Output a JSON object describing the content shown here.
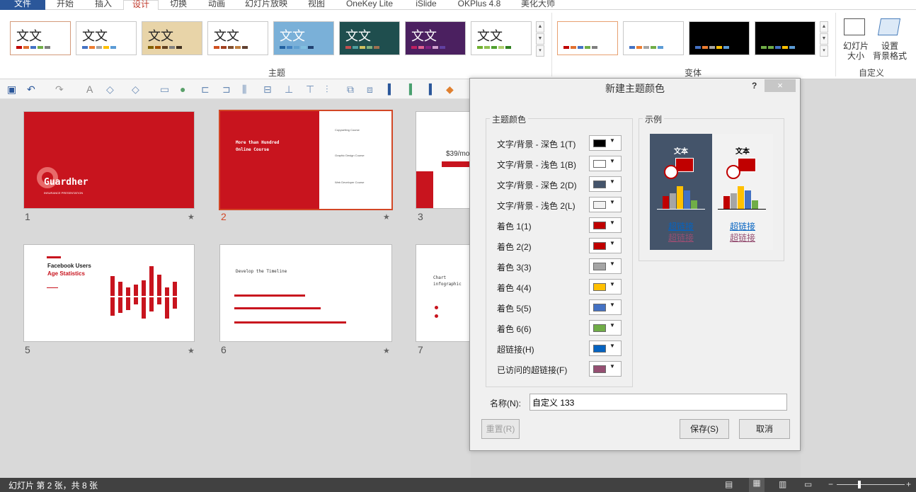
{
  "tabs": [
    "文件",
    "开始",
    "插入",
    "设计",
    "切换",
    "动画",
    "幻灯片放映",
    "视图",
    "OneKey Lite",
    "iSlide",
    "OKPlus 4.8",
    "美化大师"
  ],
  "ribbon": {
    "themes": [
      {
        "label": "文文",
        "bg": "#ffffff",
        "border": "#d39a7a",
        "colors": [
          "#c00000",
          "#e07030",
          "#4472c4",
          "#70ad47",
          "#7f7f7f"
        ]
      },
      {
        "label": "文文",
        "bg": "#ffffff",
        "border": "#c8c8c8",
        "colors": [
          "#4472c4",
          "#ed7d31",
          "#a5a5a5",
          "#ffc000",
          "#5b9bd5"
        ]
      },
      {
        "label": "文文",
        "bg": "#e8d4a8",
        "border": "#c8c8c8",
        "colors": [
          "#7f6000",
          "#a05000",
          "#604020",
          "#808080",
          "#403020"
        ]
      },
      {
        "label": "文文",
        "bg": "#ffffff",
        "border": "#c8c8c8",
        "colors": [
          "#d05020",
          "#a04020",
          "#805030",
          "#c08040",
          "#604030"
        ]
      },
      {
        "label": "文文",
        "bg": "#7ab0d8",
        "border": "#c8c8c8",
        "colors": [
          "#2060a0",
          "#4080c0",
          "#60a0d0",
          "#80c0e0",
          "#204070"
        ]
      },
      {
        "label": "文文",
        "bg": "#1f4e4e",
        "border": "#c8c8c8",
        "colors": [
          "#c05050",
          "#50a0a0",
          "#d0c060",
          "#80b080",
          "#a07050"
        ]
      },
      {
        "label": "文文",
        "bg": "#4b2060",
        "border": "#c8c8c8",
        "colors": [
          "#c02060",
          "#e06090",
          "#802080",
          "#d0a0d0",
          "#6040a0"
        ]
      },
      {
        "label": "文文",
        "bg": "#ffffff",
        "border": "#c8c8c8",
        "colors": [
          "#70b030",
          "#90c050",
          "#50a030",
          "#b0d070",
          "#308020"
        ]
      }
    ],
    "variants": [
      {
        "bg": "#ffffff",
        "border": "#e8a070",
        "colors": [
          "#c00000",
          "#e07030",
          "#4472c4",
          "#70ad47",
          "#7f7f7f"
        ]
      },
      {
        "bg": "#ffffff",
        "border": "#c8c8c8",
        "colors": [
          "#4472c4",
          "#ed7d31",
          "#a5a5a5",
          "#70ad47",
          "#5b9bd5"
        ]
      },
      {
        "bg": "#000000",
        "border": "#c8c8c8",
        "colors": [
          "#4472c4",
          "#ed7d31",
          "#a5a5a5",
          "#ffc000",
          "#5b9bd5"
        ]
      },
      {
        "bg": "#000000",
        "border": "#c8c8c8",
        "colors": [
          "#70ad47",
          "#70ad47",
          "#4472c4",
          "#ffc000",
          "#5b9bd5"
        ]
      }
    ],
    "group_theme": "主题",
    "group_variant": "变体",
    "group_custom": "自定义",
    "slide_size": "幻灯片\n大小",
    "format_bg": "设置\n背景格式"
  },
  "slides": [
    {
      "num": "1",
      "title": "Guardher",
      "sub": "INSURANCE PRESENTATION"
    },
    {
      "num": "2",
      "title": "More than Hundred Online Course",
      "items": [
        "Copywriting Course",
        "Graphic Design Course",
        "Web Developer Course"
      ]
    },
    {
      "num": "3",
      "title": "$39/mo"
    },
    {
      "num": "5",
      "title": "Facebook Users",
      "title2": "Age Statistics"
    },
    {
      "num": "6",
      "title": "Develop the Timeline"
    },
    {
      "num": "7",
      "title": "Chart infographic"
    }
  ],
  "dialog": {
    "title": "新建主题颜色",
    "help": "?",
    "close": "×",
    "theme_colors_label": "主题颜色",
    "sample_label": "示例",
    "rows": [
      {
        "label": "文字/背景 - 深色 1(T)",
        "color": "#000000"
      },
      {
        "label": "文字/背景 - 浅色 1(B)",
        "color": "#ffffff"
      },
      {
        "label": "文字/背景 - 深色 2(D)",
        "color": "#44546a"
      },
      {
        "label": "文字/背景 - 浅色 2(L)",
        "color": "#f2f2f2"
      },
      {
        "label": "着色 1(1)",
        "color": "#c00000"
      },
      {
        "label": "着色 2(2)",
        "color": "#c00000"
      },
      {
        "label": "着色 3(3)",
        "color": "#a5a5a5"
      },
      {
        "label": "着色 4(4)",
        "color": "#ffc000"
      },
      {
        "label": "着色 5(5)",
        "color": "#4472c4"
      },
      {
        "label": "着色 6(6)",
        "color": "#70ad47"
      },
      {
        "label": "超链接(H)",
        "color": "#0563c1"
      },
      {
        "label": "已访问的超链接(F)",
        "color": "#954f72"
      }
    ],
    "sample_text": "文本",
    "sample_link": "超链接",
    "sample_visited": "超链接",
    "name_label": "名称(N):",
    "name_value": "自定义 133",
    "reset": "重置(R)",
    "save": "保存(S)",
    "cancel": "取消"
  },
  "status": {
    "text": "幻灯片 第 2 张，共 8 张"
  }
}
